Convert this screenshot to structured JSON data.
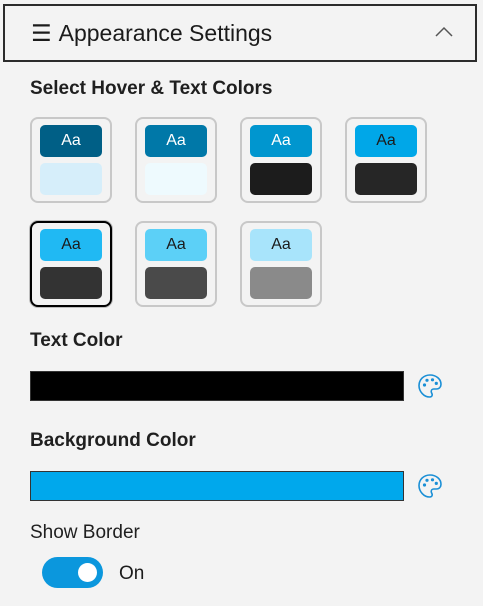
{
  "header": {
    "menu_glyph": "☰",
    "title": "Appearance Settings",
    "collapse_icon": "chevron-up-icon"
  },
  "hover_text": {
    "label": "Select Hover & Text Colors",
    "swatches": [
      {
        "text": "Aa",
        "top_bg": "#005f86",
        "text_color": "#ffffff",
        "bottom_bg": "#d6eefa",
        "selected": false
      },
      {
        "text": "Aa",
        "top_bg": "#0078a8",
        "text_color": "#ffffff",
        "bottom_bg": "#eefafe",
        "selected": false
      },
      {
        "text": "Aa",
        "top_bg": "#0096cf",
        "text_color": "#ffffff",
        "bottom_bg": "#1c1c1c",
        "selected": false
      },
      {
        "text": "Aa",
        "top_bg": "#00a7e8",
        "text_color": "#1b1b1b",
        "bottom_bg": "#262626",
        "selected": false
      },
      {
        "text": "Aa",
        "top_bg": "#20b9f3",
        "text_color": "#1b1b1b",
        "bottom_bg": "#333333",
        "selected": true
      },
      {
        "text": "Aa",
        "top_bg": "#5cd0f7",
        "text_color": "#1b1b1b",
        "bottom_bg": "#4a4a4a",
        "selected": false
      },
      {
        "text": "Aa",
        "top_bg": "#a8e4fb",
        "text_color": "#1b1b1b",
        "bottom_bg": "#8a8a8a",
        "selected": false
      }
    ]
  },
  "text_color": {
    "label": "Text Color",
    "value": "#000000",
    "picker_icon": "palette-icon"
  },
  "background_color": {
    "label": "Background Color",
    "value": "#00a8ec",
    "picker_icon": "palette-icon"
  },
  "border": {
    "label": "Show Border",
    "toggle_on": true,
    "state_label": "On",
    "accent": "#0b97dd"
  }
}
